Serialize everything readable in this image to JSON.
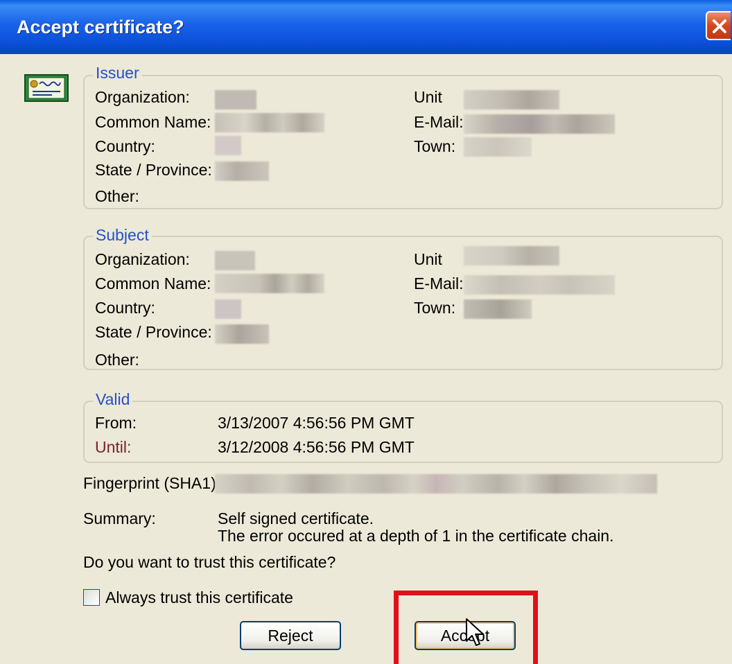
{
  "window": {
    "title": "Accept certificate?"
  },
  "issuer": {
    "legend": "Issuer",
    "organization_label": "Organization:",
    "common_name_label": "Common Name:",
    "country_label": "Country:",
    "state_label": "State / Province:",
    "other_label": "Other:",
    "unit_label": "Unit",
    "email_label": "E-Mail:",
    "town_label": "Town:"
  },
  "subject": {
    "legend": "Subject",
    "organization_label": "Organization:",
    "common_name_label": "Common Name:",
    "country_label": "Country:",
    "state_label": "State / Province:",
    "other_label": "Other:",
    "unit_label": "Unit",
    "email_label": "E-Mail:",
    "town_label": "Town:"
  },
  "valid": {
    "legend": "Valid",
    "from_label": "From:",
    "from_value": "3/13/2007 4:56:56 PM GMT",
    "until_label": "Until:",
    "until_value": "3/12/2008 4:56:56 PM GMT"
  },
  "fingerprint": {
    "label": "Fingerprint (SHA1):"
  },
  "summary": {
    "label": "Summary:",
    "line1": "Self signed certificate.",
    "line2": "The error occured at a depth of 1 in the certificate chain."
  },
  "question": "Do you want to trust this certificate?",
  "always_trust": {
    "label": "Always trust this certificate",
    "checked": false
  },
  "buttons": {
    "reject": "Reject",
    "accept": "Accept"
  },
  "icons": {
    "certificate": "certificate-icon",
    "close": "close-icon",
    "cursor": "mouse-pointer-icon"
  },
  "colors": {
    "titlebar": "#0a50d8",
    "background": "#ece9d8",
    "group_label": "#2450c8",
    "highlight": "#e0101a",
    "close_button": "#d8441c"
  }
}
